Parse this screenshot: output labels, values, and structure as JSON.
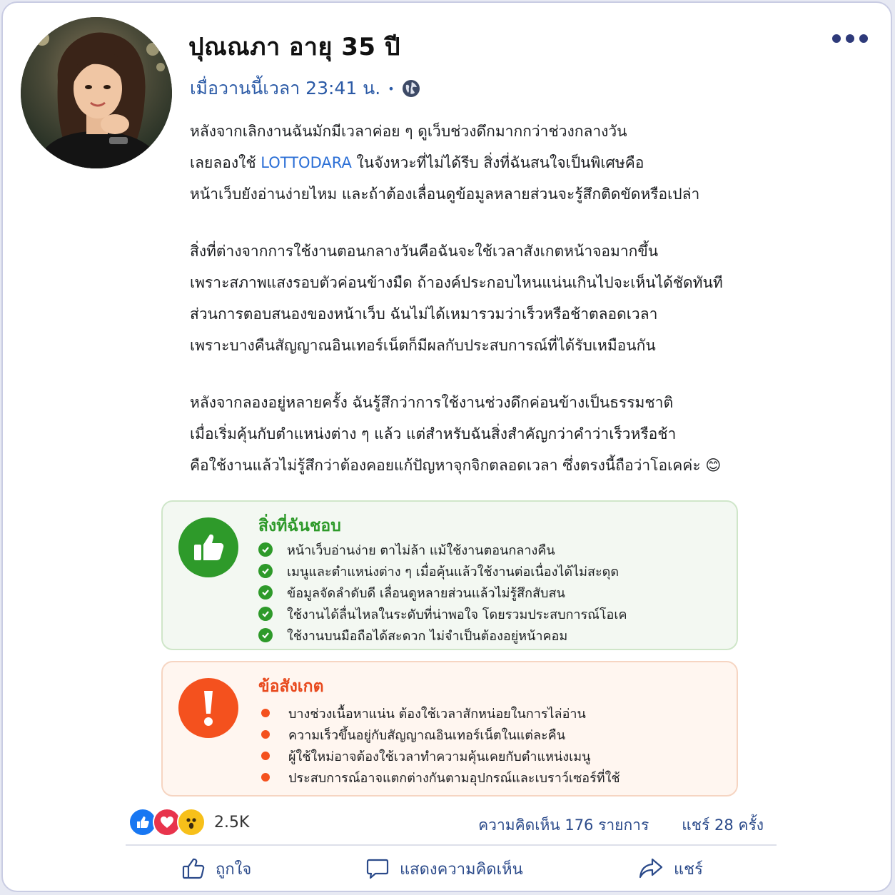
{
  "post": {
    "author": "ปุณณภา อายุ 35 ปี",
    "timestamp": "เมื่อวานนี้เวลา 23:41 น.",
    "privacy_icon": "globe-icon",
    "paragraphs": [
      {
        "lines": [
          "หลังจากเลิกงานฉันมักมีเวลาค่อย ๆ ดูเว็บช่วงดึกมากกว่าช่วงกลางวัน",
          "",
          "หน้าเว็บยังอ่านง่ายไหม และถ้าต้องเลื่อนดูข้อมูลหลายส่วนจะรู้สึกติดขัดหรือเปล่า"
        ],
        "line2_before": "เลยลองใช้ ",
        "line2_link": "LOTTODARA",
        "line2_after": " ในจังหวะที่ไม่ได้รีบ สิ่งที่ฉันสนใจเป็นพิเศษคือ"
      },
      {
        "lines": [
          "สิ่งที่ต่างจากการใช้งานตอนกลางวันคือฉันจะใช้เวลาสังเกตหน้าจอมากขึ้น",
          "เพราะสภาพแสงรอบตัวค่อนข้างมืด ถ้าองค์ประกอบไหนแน่นเกินไปจะเห็นได้ชัดทันที",
          "ส่วนการตอบสนองของหน้าเว็บ ฉันไม่ได้เหมารวมว่าเร็วหรือช้าตลอดเวลา",
          "เพราะบางคืนสัญญาณอินเทอร์เน็ตก็มีผลกับประสบการณ์ที่ได้รับเหมือนกัน"
        ]
      },
      {
        "lines": [
          "หลังจากลองอยู่หลายครั้ง ฉันรู้สึกว่าการใช้งานช่วงดึกค่อนข้างเป็นธรรมชาติ",
          "เมื่อเริ่มคุ้นกับตำแหน่งต่าง ๆ แล้ว แต่สำหรับฉันสิ่งสำคัญกว่าคำว่าเร็วหรือช้า",
          "คือใช้งานแล้วไม่รู้สึกว่าต้องคอยแก้ปัญหาจุกจิกตลอดเวลา ซึ่งตรงนี้ถือว่าโอเคค่ะ"
        ],
        "emoji": "😊"
      }
    ]
  },
  "likes_box": {
    "title": "สิ่งที่ฉันชอบ",
    "icon": "thumbs-up-icon",
    "items": [
      "หน้าเว็บอ่านง่าย ตาไม่ล้า แม้ใช้งานตอนกลางคืน",
      "เมนูและตำแหน่งต่าง ๆ เมื่อคุ้นแล้วใช้งานต่อเนื่องได้ไม่สะดุด",
      "ข้อมูลจัดลำดับดี เลื่อนดูหลายส่วนแล้วไม่รู้สึกสับสน",
      "ใช้งานได้ลื่นไหลในระดับที่น่าพอใจ โดยรวมประสบการณ์โอเค",
      "ใช้งานบนมือถือได้สะดวก ไม่จำเป็นต้องอยู่หน้าคอม"
    ]
  },
  "notes_box": {
    "title": "ข้อสังเกต",
    "icon": "exclamation-icon",
    "items": [
      "บางช่วงเนื้อหาแน่น ต้องใช้เวลาสักหน่อยในการไล่อ่าน",
      "ความเร็วขึ้นอยู่กับสัญญาณอินเทอร์เน็ตในแต่ละคืน",
      "ผู้ใช้ใหม่อาจต้องใช้เวลาทำความคุ้นเคยกับตำแหน่งเมนู",
      "ประสบการณ์อาจแตกต่างกันตามอุปกรณ์และเบราว์เซอร์ที่ใช้"
    ]
  },
  "engagement": {
    "reaction_count": "2.5K",
    "reactions": [
      "like-reaction-icon",
      "love-reaction-icon",
      "wow-reaction-icon"
    ],
    "comments": "ความคิดเห็น 176 รายการ",
    "shares": "แชร์ 28 ครั้ง"
  },
  "actions": {
    "like": "ถูกใจ",
    "comment": "แสดงความคิดเห็น",
    "share": "แชร์"
  },
  "colors": {
    "accent_blue": "#2b6fd6",
    "positive_green": "#2e9a2a",
    "warning_orange": "#f4511e"
  }
}
